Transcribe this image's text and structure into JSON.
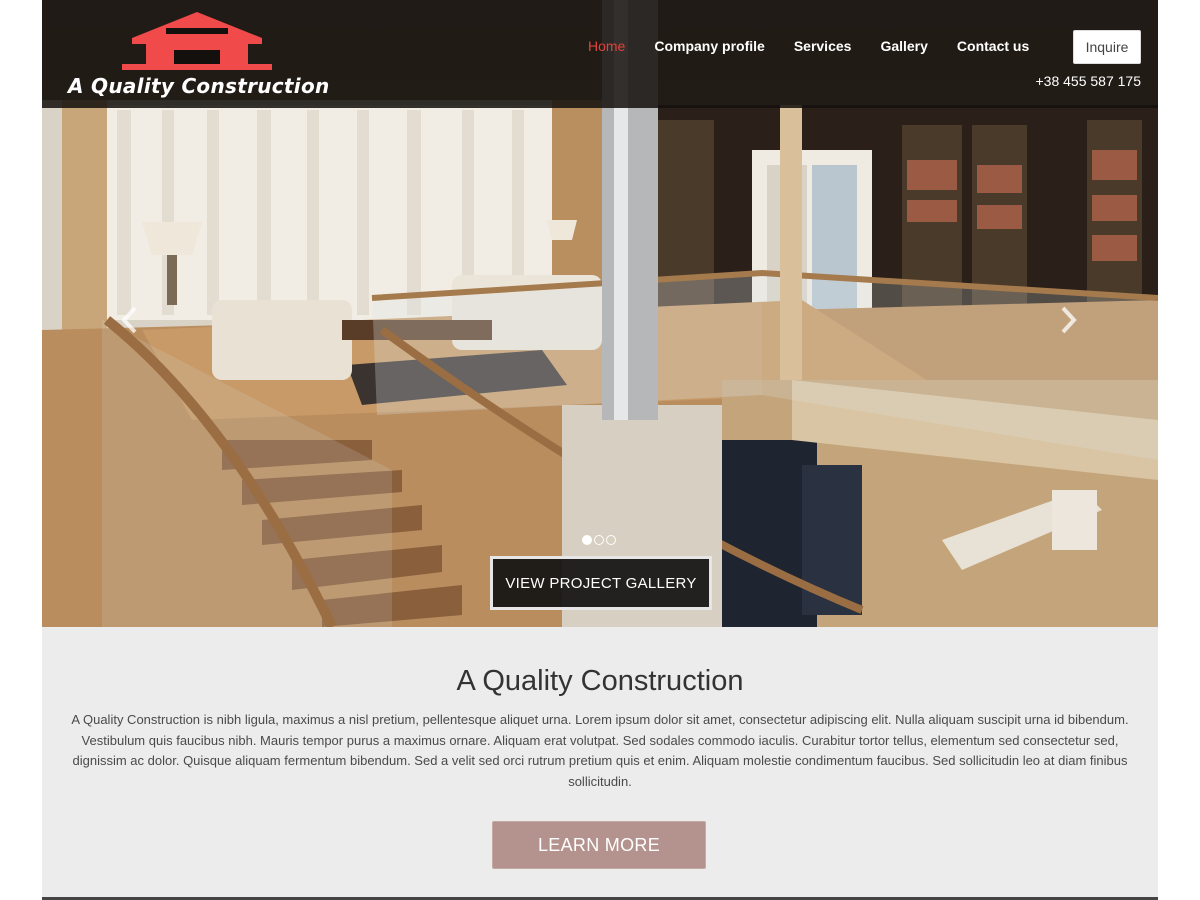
{
  "brand": {
    "name": "A Quality Construction",
    "logo_color": "#f04a4a"
  },
  "nav": {
    "items": [
      {
        "label": "Home",
        "active": true
      },
      {
        "label": "Company profile",
        "active": false
      },
      {
        "label": "Services",
        "active": false
      },
      {
        "label": "Gallery",
        "active": false
      },
      {
        "label": "Contact us",
        "active": false
      }
    ],
    "active_color": "#e0433c"
  },
  "header": {
    "inquire_label": "Inquire",
    "phone": "+38 455 587 175"
  },
  "carousel": {
    "slide_count": 3,
    "active_slide": 1,
    "prev_icon": "chevron-left-icon",
    "next_icon": "chevron-right-icon",
    "cta_label": "VIEW PROJECT GALLERY"
  },
  "intro": {
    "title": "A Quality Construction",
    "body": "A Quality Construction is nibh ligula, maximus a nisl pretium, pellentesque aliquet urna. Lorem ipsum dolor sit amet, consectetur adipiscing elit. Nulla aliquam suscipit urna id bibendum. Vestibulum quis faucibus nibh. Mauris tempor purus a maximus ornare. Aliquam erat volutpat. Sed sodales commodo iaculis. Curabitur tortor tellus, elementum sed consectetur sed, dignissim ac dolor. Quisque aliquam fermentum bibendum. Sed a velit sed orci rutrum pretium quis et enim. Aliquam molestie condimentum faucibus. Sed sollicitudin leo at diam finibus sollicitudin.",
    "button_label": "LEARN MORE",
    "button_color": "#b4928d"
  }
}
